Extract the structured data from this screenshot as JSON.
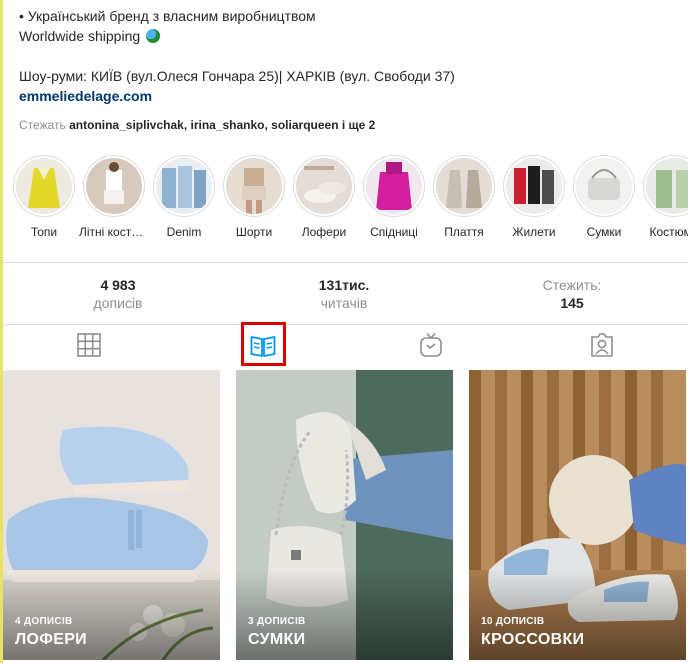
{
  "bio": {
    "line1": "• Український бренд з власним виробництвом",
    "line2": "Worldwide shipping",
    "line3": "Шоу-руми: КИЇВ (вул.Олеся Гончара 25)| ХАРКІВ (вул. Свободи 37)",
    "website": "emmeliedelage.com",
    "globe_icon": "globe-icon"
  },
  "followed_by": {
    "prefix": "Стежать",
    "users": "antonina_siplivchak, irina_shanko, soliarqueen",
    "suffix": "і ще 2"
  },
  "highlights": [
    {
      "label": "Топи",
      "color": "#e2d92a"
    },
    {
      "label": "Літні костюми",
      "color": "#d8c9bd"
    },
    {
      "label": "Denim",
      "color": "#8fb2d1"
    },
    {
      "label": "Шорти",
      "color": "#c9ae95"
    },
    {
      "label": "Лофери",
      "color": "#d9cfc6"
    },
    {
      "label": "Спідниці",
      "color": "#d11fa0"
    },
    {
      "label": "Плаття",
      "color": "#c8bfb4"
    },
    {
      "label": "Жилети",
      "color": "#cc2030"
    },
    {
      "label": "Сумки",
      "color": "#d8d8d6"
    },
    {
      "label": "Костюми",
      "color": "#9cbf92"
    }
  ],
  "stats": {
    "posts_value": "4 983",
    "posts_label": "дописів",
    "followers_value": "131тис.",
    "followers_label": "читачів",
    "following_label": "Стежить:",
    "following_value": "145"
  },
  "tabs": [
    {
      "name": "posts",
      "icon": "grid-icon"
    },
    {
      "name": "guides",
      "icon": "guide-book-icon",
      "active": true
    },
    {
      "name": "igtv",
      "icon": "tv-icon"
    },
    {
      "name": "tagged",
      "icon": "tagged-user-icon"
    }
  ],
  "guides": [
    {
      "count": "4 ДОПИСІВ",
      "title": "ЛОФЕРИ"
    },
    {
      "count": "3 ДОПИСІВ",
      "title": "СУМКИ"
    },
    {
      "count": "10 ДОПИСІВ",
      "title": "КРОССОВКИ"
    }
  ],
  "colors": {
    "link": "#00376b",
    "muted": "#8e8e8e",
    "active_tab": "#0095f6",
    "highlight_box": "#e00000"
  }
}
